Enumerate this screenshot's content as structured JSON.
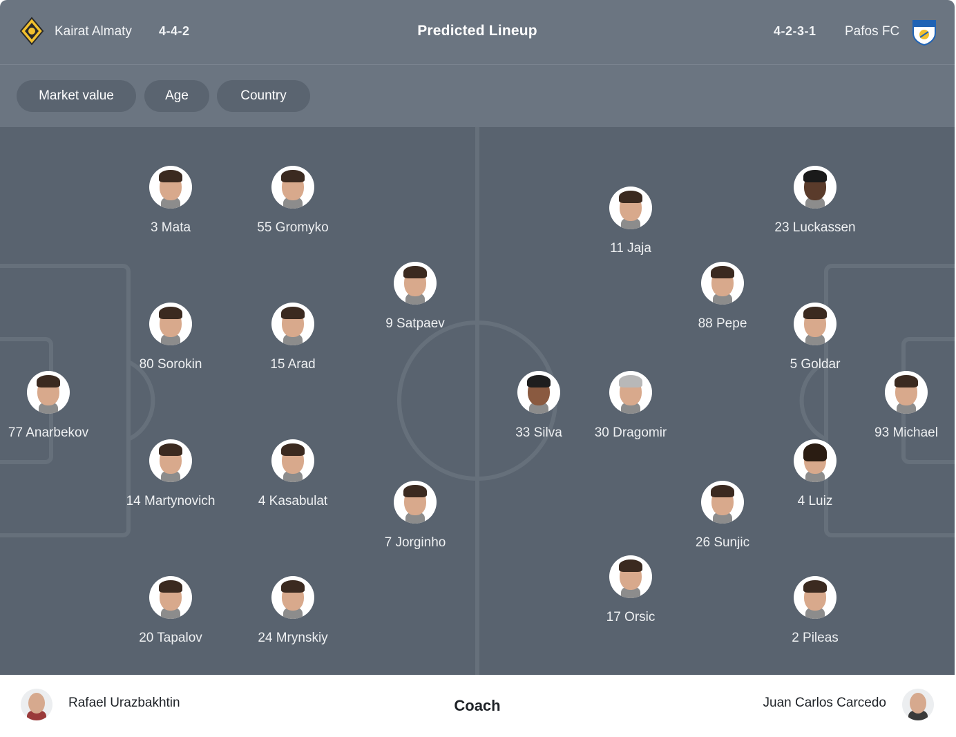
{
  "header": {
    "title": "Predicted Lineup",
    "home": {
      "name": "Kairat Almaty",
      "formation": "4-4-2",
      "crest": "kairat-crest-icon"
    },
    "away": {
      "name": "Pafos FC",
      "formation": "4-2-3-1",
      "crest": "pafos-crest-icon"
    }
  },
  "filters": [
    "Market value",
    "Age",
    "Country"
  ],
  "players": [
    {
      "label": "3 Mata"
    },
    {
      "label": "55 Gromyko"
    },
    {
      "label": "9 Satpaev"
    },
    {
      "label": "80 Sorokin"
    },
    {
      "label": "15 Arad"
    },
    {
      "label": "77 Anarbekov"
    },
    {
      "label": "14 Martynovich"
    },
    {
      "label": "4 Kasabulat"
    },
    {
      "label": "7 Jorginho"
    },
    {
      "label": "20 Tapalov"
    },
    {
      "label": "24 Mrynskiy"
    },
    {
      "label": "11 Jaja"
    },
    {
      "label": "23 Luckassen"
    },
    {
      "label": "88 Pepe"
    },
    {
      "label": "5 Goldar"
    },
    {
      "label": "33 Silva"
    },
    {
      "label": "30 Dragomir"
    },
    {
      "label": "93 Michael"
    },
    {
      "label": "4 Luiz"
    },
    {
      "label": "26 Sunjic"
    },
    {
      "label": "17 Orsic"
    },
    {
      "label": "2 Pileas"
    }
  ],
  "footer": {
    "label": "Coach",
    "home_coach": "Rafael Urazbakhtin",
    "away_coach": "Juan Carlos Carcedo"
  },
  "colors": {
    "header_bg": "#6b7581",
    "pitch_bg": "#59636f",
    "chip_bg": "#5a6470",
    "pitch_lines": "#6a747f"
  }
}
